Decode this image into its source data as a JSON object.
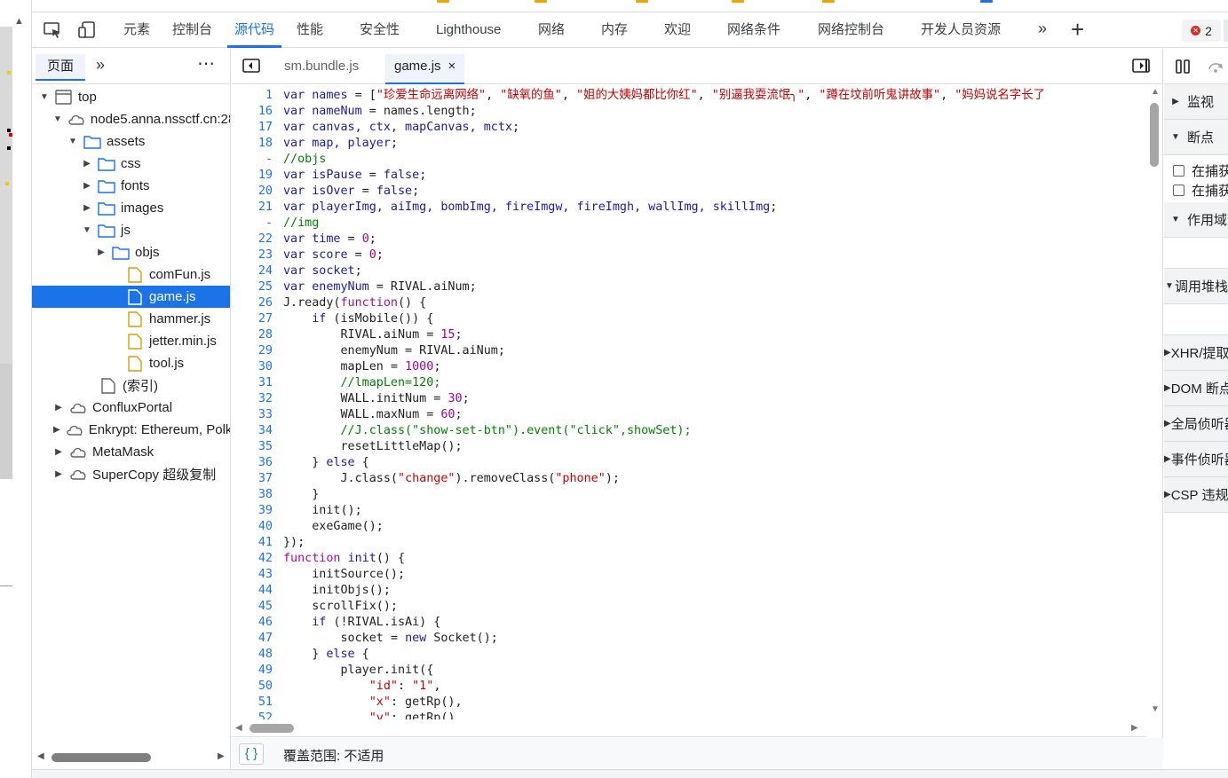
{
  "toolbar": {
    "tabs": [
      {
        "label": "元素"
      },
      {
        "label": "控制台"
      },
      {
        "label": "源代码"
      },
      {
        "label": "性能"
      },
      {
        "label": "安全性"
      },
      {
        "label": "Lighthouse"
      },
      {
        "label": "网络"
      },
      {
        "label": "内存"
      },
      {
        "label": "欢迎"
      },
      {
        "label": "网络条件"
      },
      {
        "label": "网络控制台"
      },
      {
        "label": "开发人员资源"
      }
    ],
    "active_tab": "源代码",
    "error_count": "2",
    "accent_color": "#1a73e8",
    "error_color": "#d93025"
  },
  "navigator": {
    "tab_label": "页面",
    "tree": [
      {
        "label": "top",
        "icon": "frame-icon",
        "expanded": true
      },
      {
        "label": "node5.anna.nssctf.cn:28",
        "icon": "cloud-icon",
        "expanded": true
      },
      {
        "label": "assets",
        "icon": "folder-icon",
        "expanded": true
      },
      {
        "label": "css",
        "icon": "folder-icon",
        "expanded": false
      },
      {
        "label": "fonts",
        "icon": "folder-icon",
        "expanded": false
      },
      {
        "label": "images",
        "icon": "folder-icon",
        "expanded": false
      },
      {
        "label": "js",
        "icon": "folder-icon",
        "expanded": true
      },
      {
        "label": "objs",
        "icon": "folder-icon",
        "expanded": false
      },
      {
        "label": "comFun.js",
        "icon": "file-js-icon"
      },
      {
        "label": "game.js",
        "icon": "file-js-icon",
        "selected": true
      },
      {
        "label": "hammer.js",
        "icon": "file-js-icon"
      },
      {
        "label": "jetter.min.js",
        "icon": "file-js-icon"
      },
      {
        "label": "tool.js",
        "icon": "file-js-icon"
      },
      {
        "label": "(索引)",
        "icon": "file-icon"
      },
      {
        "label": "ConfluxPortal",
        "icon": "cloud-icon",
        "expanded": false
      },
      {
        "label": "Enkrypt: Ethereum, Polk",
        "icon": "cloud-icon",
        "expanded": false
      },
      {
        "label": "MetaMask",
        "icon": "cloud-icon",
        "expanded": false
      },
      {
        "label": "SuperCopy 超级复制",
        "icon": "cloud-icon",
        "expanded": false
      }
    ]
  },
  "editor": {
    "tabs": [
      {
        "label": "sm.bundle.js"
      },
      {
        "label": "game.js",
        "close": "×"
      }
    ],
    "active_file": "game.js",
    "lines": [
      {
        "n": "1",
        "code": "var names = [\"珍爱生命远离网络\", \"缺氧的鱼\", \"姐的大姨妈都比你红\", \"别逼我耍流氓╮\", \"蹲在坟前听鬼讲故事\", \"妈妈说名字长了"
      },
      {
        "n": "16",
        "code": "var nameNum = names.length;"
      },
      {
        "n": "17",
        "code": "var canvas, ctx, mapCanvas, mctx;"
      },
      {
        "n": "18",
        "code": "var map, player;"
      },
      {
        "n": "-",
        "code": "//objs"
      },
      {
        "n": "19",
        "code": "var isPause = false;"
      },
      {
        "n": "20",
        "code": "var isOver = false;"
      },
      {
        "n": "21",
        "code": "var playerImg, aiImg, bombImg, fireImgw, fireImgh, wallImg, skillImg;"
      },
      {
        "n": "-",
        "code": "//img"
      },
      {
        "n": "22",
        "code": "var time = 0;"
      },
      {
        "n": "23",
        "code": "var score = 0;"
      },
      {
        "n": "24",
        "code": "var socket;"
      },
      {
        "n": "25",
        "code": "var enemyNum = RIVAL.aiNum;"
      },
      {
        "n": "26",
        "code": "J.ready(function() {"
      },
      {
        "n": "27",
        "code": "    if (isMobile()) {"
      },
      {
        "n": "28",
        "code": "        RIVAL.aiNum = 15;"
      },
      {
        "n": "29",
        "code": "        enemyNum = RIVAL.aiNum;"
      },
      {
        "n": "30",
        "code": "        mapLen = 1000;"
      },
      {
        "n": "31",
        "code": "        //lmapLen=120;"
      },
      {
        "n": "32",
        "code": "        WALL.initNum = 30;"
      },
      {
        "n": "33",
        "code": "        WALL.maxNum = 60;"
      },
      {
        "n": "34",
        "code": "        //J.class(\"show-set-btn\").event(\"click\",showSet);"
      },
      {
        "n": "35",
        "code": "        resetLittleMap();"
      },
      {
        "n": "36",
        "code": "    } else {"
      },
      {
        "n": "37",
        "code": "        J.class(\"change\").removeClass(\"phone\");"
      },
      {
        "n": "38",
        "code": "    }"
      },
      {
        "n": "39",
        "code": "    init();"
      },
      {
        "n": "40",
        "code": "    exeGame();"
      },
      {
        "n": "41",
        "code": "});"
      },
      {
        "n": "42",
        "code": "function init() {"
      },
      {
        "n": "43",
        "code": "    initSource();"
      },
      {
        "n": "44",
        "code": "    initObjs();"
      },
      {
        "n": "45",
        "code": "    scrollFix();"
      },
      {
        "n": "46",
        "code": "    if (!RIVAL.isAi) {"
      },
      {
        "n": "47",
        "code": "        socket = new Socket();"
      },
      {
        "n": "48",
        "code": "    } else {"
      },
      {
        "n": "49",
        "code": "        player.init({"
      },
      {
        "n": "50",
        "code": "            \"id\": \"1\","
      },
      {
        "n": "51",
        "code": "            \"x\": getRp(),"
      },
      {
        "n": "52",
        "code": "            \"y\": getRp(),"
      }
    ],
    "pretty_print": "{ }",
    "coverage": "覆盖范围: 不适用",
    "syntax_colors": {
      "keyword": "#1a1aa6",
      "string": "#c80000",
      "number": "#a000a0",
      "comment": "#008000",
      "identifier": "#202124",
      "function_keyword": "#aa0d91",
      "line_number": "#1a73e8"
    }
  },
  "debugger": {
    "sections": [
      {
        "label": "监视",
        "expanded": false
      },
      {
        "label": "断点",
        "expanded": true
      },
      {
        "label": "作用域",
        "expanded": true
      },
      {
        "label": "调用堆栈",
        "expanded": true
      },
      {
        "label": "XHR/提取断点",
        "expanded": false
      },
      {
        "label": "DOM 断点",
        "expanded": false
      },
      {
        "label": "全局侦听器",
        "expanded": false
      },
      {
        "label": "事件侦听器断点",
        "expanded": false
      },
      {
        "label": "CSP 违规断点",
        "expanded": false
      }
    ],
    "checkboxes": [
      {
        "label": "在捕获的异常时暂停"
      },
      {
        "label": "在捕获的异常时暂停"
      }
    ]
  }
}
